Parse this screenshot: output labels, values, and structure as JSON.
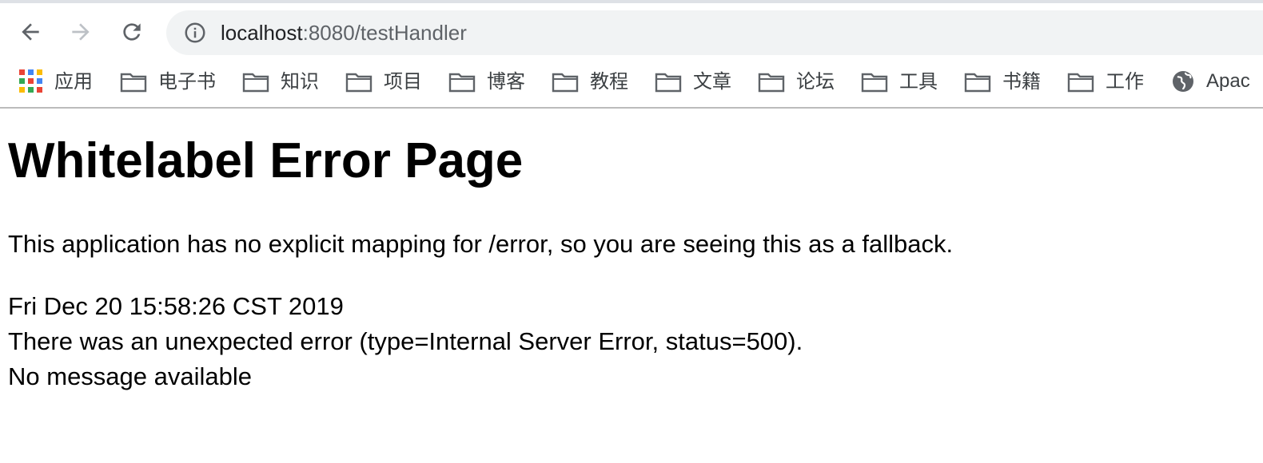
{
  "browser": {
    "url_host": "localhost",
    "url_rest": ":8080/testHandler"
  },
  "bookmarks": [
    {
      "label": "应用",
      "icon": "apps-icon"
    },
    {
      "label": "电子书",
      "icon": "folder-icon"
    },
    {
      "label": "知识",
      "icon": "folder-icon"
    },
    {
      "label": "项目",
      "icon": "folder-icon"
    },
    {
      "label": "博客",
      "icon": "folder-icon"
    },
    {
      "label": "教程",
      "icon": "folder-icon"
    },
    {
      "label": "文章",
      "icon": "folder-icon"
    },
    {
      "label": "论坛",
      "icon": "folder-icon"
    },
    {
      "label": "工具",
      "icon": "folder-icon"
    },
    {
      "label": "书籍",
      "icon": "folder-icon"
    },
    {
      "label": "工作",
      "icon": "folder-icon"
    },
    {
      "label": "Apac",
      "icon": "globe-icon"
    }
  ],
  "page": {
    "title": "Whitelabel Error Page",
    "description": "This application has no explicit mapping for /error, so you are seeing this as a fallback.",
    "timestamp": "Fri Dec 20 15:58:26 CST 2019",
    "error_line": "There was an unexpected error (type=Internal Server Error, status=500).",
    "message": "No message available"
  },
  "colors": {
    "toolbar_icon": "#5f6368",
    "disabled_icon": "#bdc1c6",
    "omnibox_bg": "#f1f3f4"
  }
}
